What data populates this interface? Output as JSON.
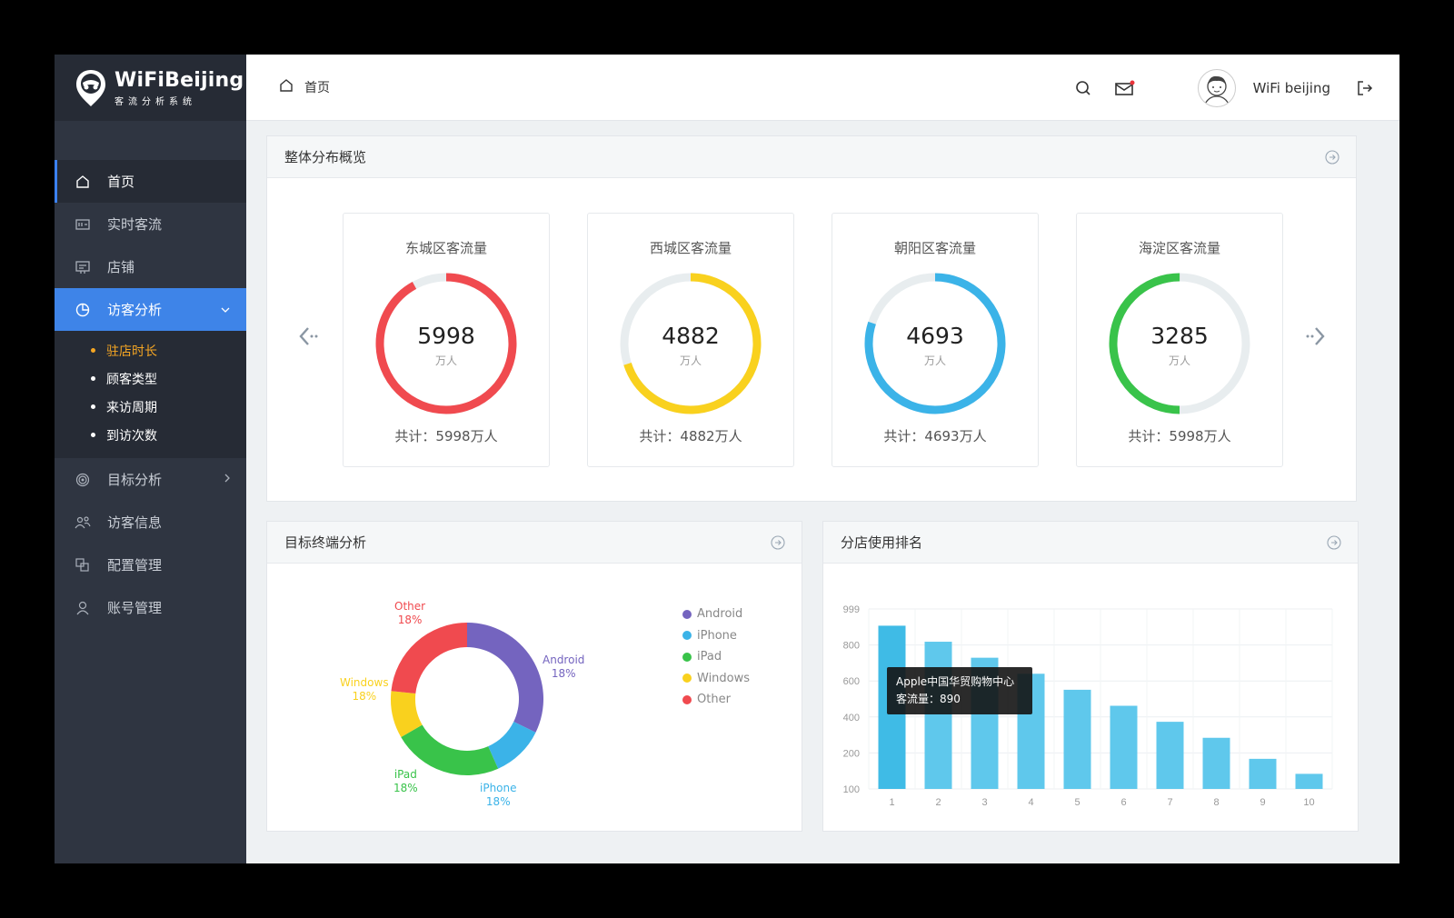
{
  "app": {
    "logo_title": "WiFiBeijing",
    "logo_subtitle": "客流分析系统"
  },
  "sidebar": {
    "items": [
      {
        "label": "首页",
        "icon": "home-icon"
      },
      {
        "label": "实时客流",
        "icon": "realtime-icon"
      },
      {
        "label": "店铺",
        "icon": "store-icon"
      },
      {
        "label": "访客分析",
        "icon": "pie-icon",
        "expanded": true
      },
      {
        "label": "目标分析",
        "icon": "target-icon"
      },
      {
        "label": "访客信息",
        "icon": "users-icon"
      },
      {
        "label": "配置管理",
        "icon": "config-icon"
      },
      {
        "label": "账号管理",
        "icon": "account-icon"
      }
    ],
    "sub_items": [
      "驻店时长",
      "顾客类型",
      "来访周期",
      "到访次数"
    ]
  },
  "topbar": {
    "breadcrumb": "首页",
    "username": "WiFi beijing"
  },
  "overview": {
    "title": "整体分布概览",
    "cards": [
      {
        "title": "东城区客流量",
        "value": "5998",
        "unit": "万人",
        "total": "共计：5998万人",
        "fraction": 0.92,
        "color": "#f04a4f"
      },
      {
        "title": "西城区客流量",
        "value": "4882",
        "unit": "万人",
        "total": "共计：4882万人",
        "fraction": 0.7,
        "color": "#f9d11e"
      },
      {
        "title": "朝阳区客流量",
        "value": "4693",
        "unit": "万人",
        "total": "共计：4693万人",
        "fraction": 0.8,
        "color": "#3bb3e8"
      },
      {
        "title": "海淀区客流量",
        "value": "3285",
        "unit": "万人",
        "total": "共计：5998万人",
        "fraction": 0.5,
        "color": "#39c34a"
      }
    ]
  },
  "terminal": {
    "title": "目标终端分析",
    "legend": [
      "Android",
      "iPhone",
      "iPad",
      "Windows",
      "Other"
    ],
    "labels": [
      {
        "name": "Android",
        "pct": "18%"
      },
      {
        "name": "iPhone",
        "pct": "18%"
      },
      {
        "name": "iPad",
        "pct": "18%"
      },
      {
        "name": "Windows",
        "pct": "18%"
      },
      {
        "name": "Other",
        "pct": "18%"
      }
    ]
  },
  "ranking": {
    "title": "分店使用排名",
    "tooltip_name": "Apple中国华贸购物中心",
    "tooltip_value": "客流量：890"
  },
  "chart_data": [
    {
      "type": "pie",
      "title": "目标终端分析",
      "categories": [
        "Android",
        "iPhone",
        "iPad",
        "Windows",
        "Other"
      ],
      "values": [
        18,
        18,
        18,
        18,
        18
      ],
      "displayed_share_deg": [
        116,
        40,
        84,
        36,
        84
      ],
      "colors": [
        "#7464bf",
        "#3bb3e8",
        "#39c34a",
        "#f9d11e",
        "#f04a4f"
      ]
    },
    {
      "type": "bar",
      "title": "分店使用排名",
      "categories": [
        "1",
        "2",
        "3",
        "4",
        "5",
        "6",
        "7",
        "8",
        "9",
        "10"
      ],
      "values": [
        870,
        790,
        710,
        630,
        550,
        470,
        390,
        310,
        205,
        130
      ],
      "y_ticks": [
        "999",
        "800",
        "600",
        "400",
        "200",
        "100"
      ],
      "ylim": [
        100,
        999
      ],
      "bar_color": "#5fc8ec"
    }
  ]
}
